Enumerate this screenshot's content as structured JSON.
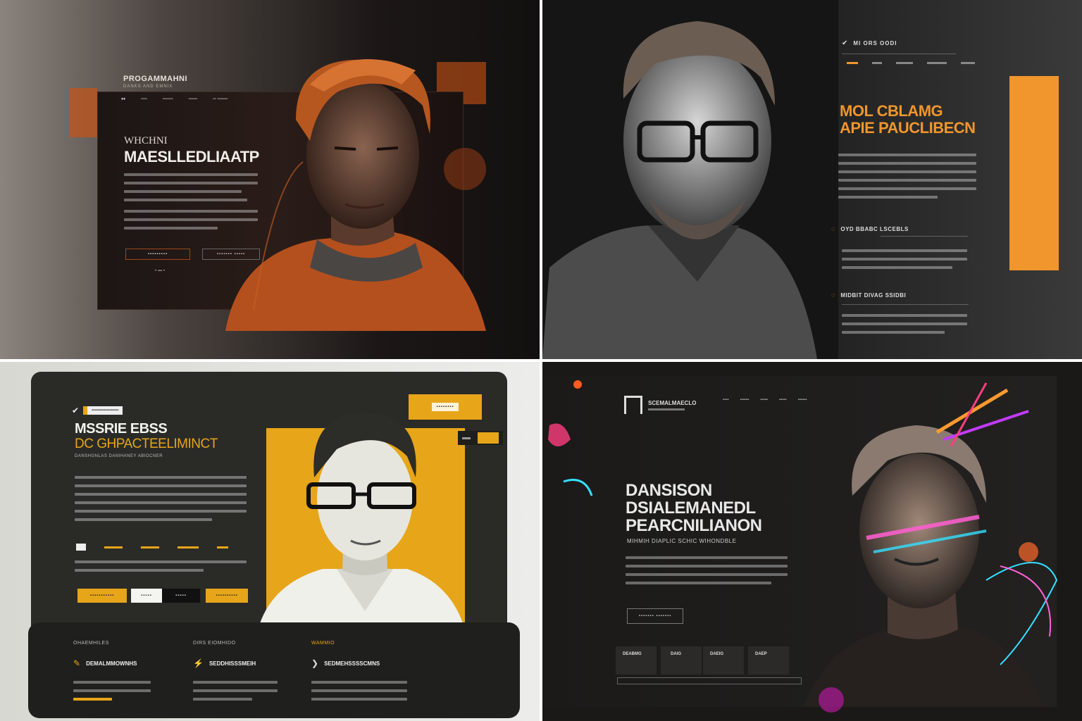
{
  "panel1": {
    "logo_title": "PROGAMMAHNI",
    "logo_sub": "DANKS AND EMNIX",
    "kicker": "WHCHNI",
    "headline": "MAESLLEDLIAATP",
    "nav": [
      "♦♦",
      "▪▪▪▪",
      "▪▪▪▪▪▪▪",
      "▪▪▪▪▪▪",
      "▪▪ ▪▪▪▪▪▪▪"
    ],
    "btn_primary": "▪▪▪▪▪▪▪▪▪",
    "btn_secondary": "▪▪▪▪▪▪▪ ▪▪▪▪▪",
    "pager": "• ▪▪▪ •",
    "accent": "#c0541c"
  },
  "panel2": {
    "nav_title": "MI ORS OODI",
    "headline_line1": "MOL CBLAMG",
    "headline_line2": "APIE PAUCLIBECN",
    "section1": "OYD BBABC LSCEBLS",
    "section2": "MIDBIT DIVAG SSIDBI",
    "accent": "#f0962c"
  },
  "panel3": {
    "badge_text": "▪▪▪▪▪▪▪▪▪▪▪▪▪▪▪▪▪▪",
    "headline_line1": "MSSRIE EBSS",
    "headline_line2": "DC GHPACTEELIMINCT",
    "subline": "DANSHGNLAS DANIHANEY ABIOCNER",
    "top_btn": "▪▪▪▪▪▪▪▪",
    "feat_titles": [
      "OHAEMHILES",
      "DIRS EIOMHIDO",
      "WAMMIO"
    ],
    "feat_heads": [
      "DEMALMMOWNHS",
      "SEDDHISSSMEIH",
      "SEDMEHSSSSCMNS"
    ],
    "buttons": [
      "▪▪▪▪▪▪▪▪▪▪▪",
      "▪▪▪▪▪",
      "▪▪▪▪▪",
      "▪▪▪▪▪▪▪▪▪▪"
    ],
    "accent": "#e7a51a"
  },
  "panel4": {
    "logo_text": "SCEMALMAECLO",
    "nav": [
      "▪▪▪▪",
      "▪▪▪▪▪▪",
      "▪▪▪▪▪",
      "▪▪▪▪▪",
      "▪▪▪▪▪▪"
    ],
    "headline_line1": "DANSISON",
    "headline_line2": "DSIALEMANEDL",
    "headline_line3": "PEARCNILIANON",
    "subline": "MIHMIH DIAPLIC SCHIC WIHONDBLE",
    "cta": "▪▪▪▪▪▪▪ ▪▪▪▪▪▪▪",
    "stats": [
      "DEABMG",
      "DAIG",
      "DAEIG",
      "DAEP"
    ]
  }
}
